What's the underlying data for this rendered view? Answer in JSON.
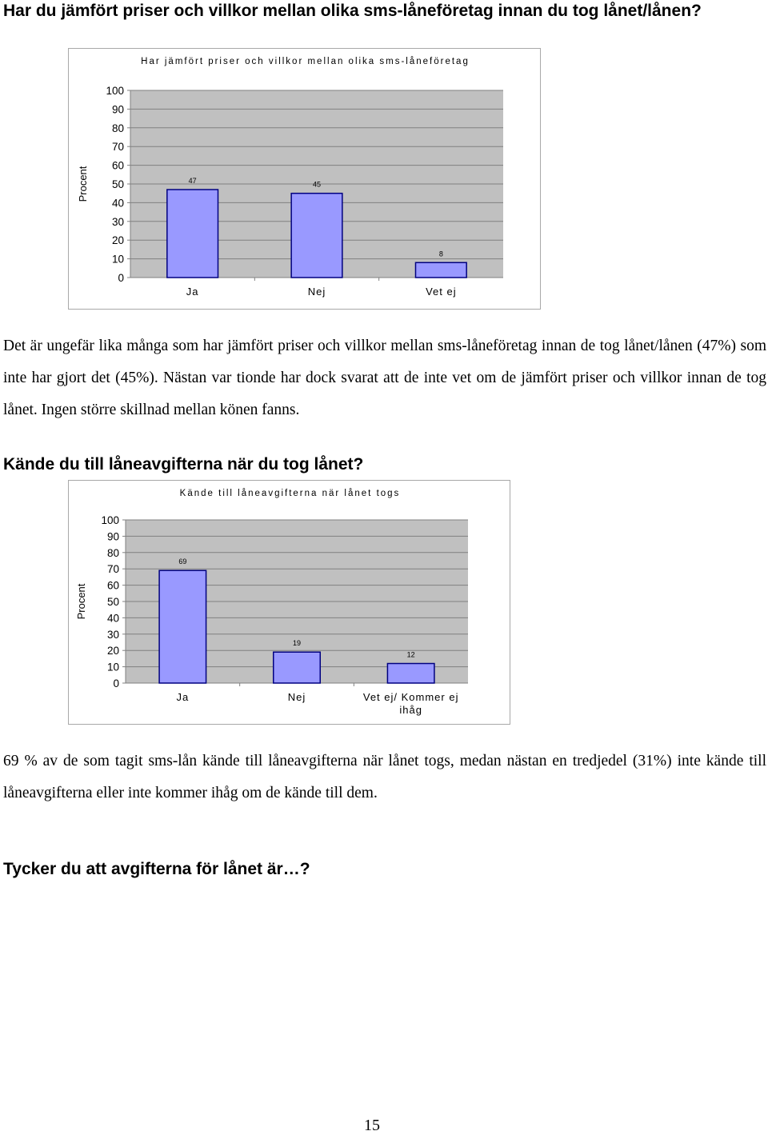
{
  "headings": {
    "q1": "Har du jämfört priser och villkor mellan olika sms-låneföretag innan du tog lånet/lånen?",
    "q2": "Kände du till låneavgifterna när du tog lånet?",
    "q3": "Tycker du att avgifterna för lånet är…?"
  },
  "paragraphs": {
    "p1": "Det är ungefär lika många som har jämfört priser och villkor mellan sms-låneföretag innan de tog lånet/lånen (47%) som inte har gjort det (45%). Nästan var tionde har dock svarat att de inte vet om de jämfört priser och villkor innan de tog lånet. Ingen större skillnad mellan könen fanns.",
    "p2": "69 % av de som tagit sms-lån kände till låneavgifterna när lånet togs, medan nästan en tredjedel (31%) inte kände till låneavgifterna eller inte kommer ihåg om de kände till dem."
  },
  "page_number": "15",
  "colors": {
    "bar_fill": "#9999ff",
    "bar_stroke": "#000080",
    "plot_bg": "#c0c0c0",
    "gridline": "#808080",
    "frame": "#a8a8a8"
  },
  "chart_data": [
    {
      "type": "bar",
      "title": "Har jämfört priser och villkor mellan olika sms-låneföretag",
      "xlabel": "",
      "ylabel": "Procent",
      "categories": [
        "Ja",
        "Nej",
        "Vet ej"
      ],
      "values": [
        47,
        45,
        8
      ],
      "data_labels": [
        "47",
        "45",
        "8"
      ],
      "ylim": [
        0,
        100
      ],
      "yticks": [
        "0",
        "10",
        "20",
        "30",
        "40",
        "50",
        "60",
        "70",
        "80",
        "90",
        "100"
      ],
      "grid": true,
      "legend": "none"
    },
    {
      "type": "bar",
      "title": "Kände till låneavgifterna när lånet togs",
      "xlabel": "",
      "ylabel": "Procent",
      "categories": [
        "Ja",
        "Nej",
        "Vet ej/ Kommer ej ihåg"
      ],
      "category_lines": [
        [
          "Ja"
        ],
        [
          "Nej"
        ],
        [
          "Vet ej/ Kommer ej",
          "ihåg"
        ]
      ],
      "values": [
        69,
        19,
        12
      ],
      "data_labels": [
        "69",
        "19",
        "12"
      ],
      "ylim": [
        0,
        100
      ],
      "yticks": [
        "0",
        "10",
        "20",
        "30",
        "40",
        "50",
        "60",
        "70",
        "80",
        "90",
        "100"
      ],
      "grid": true,
      "legend": "none"
    }
  ]
}
